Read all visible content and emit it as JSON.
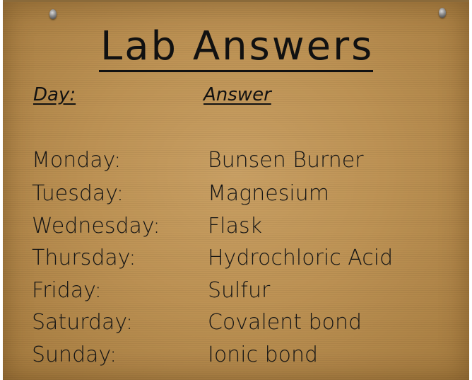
{
  "title": "Lab Answers",
  "headers": {
    "day": "Day:",
    "answer": "Answer"
  },
  "rows": [
    {
      "day": "Monday:",
      "answer": "Bunsen Burner"
    },
    {
      "day": "Tuesday:",
      "answer": "Magnesium"
    },
    {
      "day": "Wednesday:",
      "answer": "Flask"
    },
    {
      "day": "Thursday:",
      "answer": "Hydrochloric Acid"
    },
    {
      "day": "Friday:",
      "answer": "Sulfur"
    },
    {
      "day": "Saturday:",
      "answer": "Covalent bond"
    },
    {
      "day": "Sunday:",
      "answer": "Ionic bond"
    }
  ],
  "icons": {
    "left": "nail-icon",
    "right": "nail-icon"
  },
  "colors": {
    "board": "#bd9254",
    "ink": "#111111"
  }
}
